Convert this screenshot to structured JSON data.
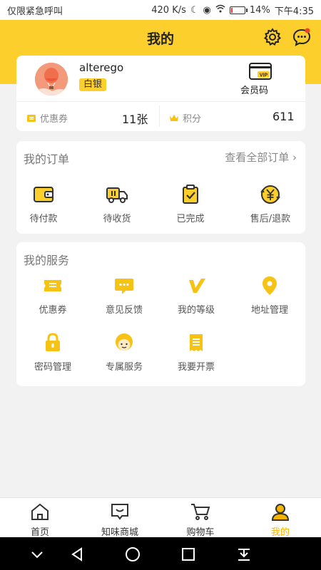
{
  "status_bar": {
    "left_text": "仅限紧急呼叫",
    "net_speed": "420 K/s",
    "battery": "14%",
    "battery_level": 0.14,
    "time": "下午4:35"
  },
  "header": {
    "title": "我的",
    "settings_icon": "gear-icon",
    "message_icon": "chat-bubble-icon"
  },
  "profile": {
    "username": "alterego",
    "level": "白银",
    "member_code_label": "会员码",
    "vip_text": "VIP",
    "coupons_label": "优惠券",
    "coupons_value": "11张",
    "points_label": "积分",
    "points_value": "611"
  },
  "orders": {
    "title": "我的订单",
    "view_all": "查看全部订单",
    "items": [
      {
        "label": "待付款",
        "icon": "wallet-icon"
      },
      {
        "label": "待收货",
        "icon": "truck-icon"
      },
      {
        "label": "已完成",
        "icon": "clipboard-check-icon"
      },
      {
        "label": "售后/退款",
        "icon": "yen-refund-icon"
      }
    ]
  },
  "services": {
    "title": "我的服务",
    "items": [
      {
        "label": "优惠券",
        "icon": "coupon-icon"
      },
      {
        "label": "意见反馈",
        "icon": "feedback-icon"
      },
      {
        "label": "我的等级",
        "icon": "level-icon"
      },
      {
        "label": "地址管理",
        "icon": "location-icon"
      },
      {
        "label": "密码管理",
        "icon": "lock-icon"
      },
      {
        "label": "专属服务",
        "icon": "service-agent-icon"
      },
      {
        "label": "我要开票",
        "icon": "invoice-icon"
      }
    ]
  },
  "tabbar": {
    "items": [
      {
        "label": "首页",
        "icon": "home-icon"
      },
      {
        "label": "知味商城",
        "icon": "mall-icon"
      },
      {
        "label": "购物车",
        "icon": "cart-icon"
      },
      {
        "label": "我的",
        "icon": "user-icon"
      }
    ]
  },
  "colors": {
    "accent": "#fccf2c",
    "active_tab": "#f4b400"
  }
}
